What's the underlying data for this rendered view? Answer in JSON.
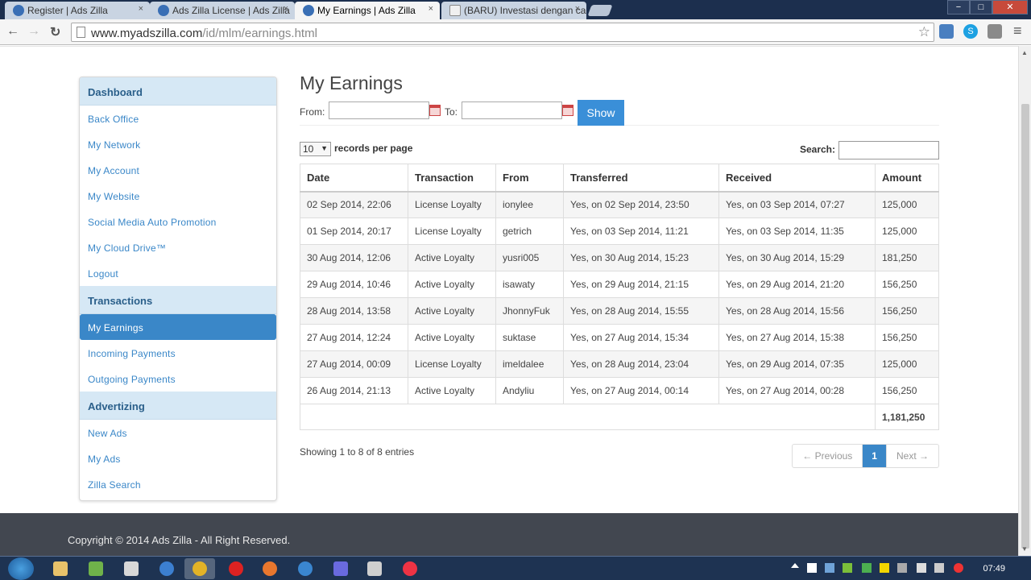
{
  "browser": {
    "tabs": [
      {
        "title": "Register | Ads Zilla",
        "close": "×"
      },
      {
        "title": "Ads Zilla License | Ads Zilla",
        "close": "×"
      },
      {
        "title": "My Earnings | Ads Zilla",
        "close": "×"
      },
      {
        "title": "(BARU) Investasi dengan car",
        "close": "×"
      }
    ],
    "url_host": "www.myadszilla.com",
    "url_path": "/id/mlm/earnings.html",
    "back": "←",
    "forward": "→",
    "reload": "↻",
    "star": "☆",
    "menu": "≡",
    "window_minimize": "−",
    "window_maximize": "□",
    "window_close": "✕"
  },
  "sidebar": {
    "sections": [
      {
        "title": "Dashboard",
        "items": [
          "Back Office",
          "My Network",
          "My Account",
          "My Website",
          "Social Media Auto Promotion",
          "My Cloud Drive™",
          "Logout"
        ]
      },
      {
        "title": "Transactions",
        "items": [
          "My Earnings",
          "Incoming Payments",
          "Outgoing Payments"
        ]
      },
      {
        "title": "Advertizing",
        "items": [
          "New Ads",
          "My Ads",
          "Zilla Search"
        ]
      }
    ]
  },
  "main": {
    "title": "My Earnings",
    "from_label": "From:",
    "to_label": "To:",
    "show_label": "Show",
    "length_value": "10",
    "length_label": "records per page",
    "search_label": "Search:",
    "columns": [
      "Date",
      "Transaction",
      "From",
      "Transferred",
      "Received",
      "Amount"
    ],
    "rows": [
      [
        "02 Sep 2014, 22:06",
        "License Loyalty",
        "ionylee",
        "Yes, on 02 Sep 2014, 23:50",
        "Yes, on 03 Sep 2014, 07:27",
        "125,000"
      ],
      [
        "01 Sep 2014, 20:17",
        "License Loyalty",
        "getrich",
        "Yes, on 03 Sep 2014, 11:21",
        "Yes, on 03 Sep 2014, 11:35",
        "125,000"
      ],
      [
        "30 Aug 2014, 12:06",
        "Active Loyalty",
        "yusri005",
        "Yes, on 30 Aug 2014, 15:23",
        "Yes, on 30 Aug 2014, 15:29",
        "181,250"
      ],
      [
        "29 Aug 2014, 10:46",
        "Active Loyalty",
        "isawaty",
        "Yes, on 29 Aug 2014, 21:15",
        "Yes, on 29 Aug 2014, 21:20",
        "156,250"
      ],
      [
        "28 Aug 2014, 13:58",
        "Active Loyalty",
        "JhonnyFuk",
        "Yes, on 28 Aug 2014, 15:55",
        "Yes, on 28 Aug 2014, 15:56",
        "156,250"
      ],
      [
        "27 Aug 2014, 12:24",
        "Active Loyalty",
        "suktase",
        "Yes, on 27 Aug 2014, 15:34",
        "Yes, on 27 Aug 2014, 15:38",
        "156,250"
      ],
      [
        "27 Aug 2014, 00:09",
        "License Loyalty",
        "imeldalee",
        "Yes, on 28 Aug 2014, 23:04",
        "Yes, on 29 Aug 2014, 07:35",
        "125,000"
      ],
      [
        "26 Aug 2014, 21:13",
        "Active Loyalty",
        "Andyliu",
        "Yes, on 27 Aug 2014, 00:14",
        "Yes, on 27 Aug 2014, 00:28",
        "156,250"
      ]
    ],
    "total": "1,181,250",
    "info": "Showing 1 to 8 of 8 entries",
    "pager": {
      "prev": "← Previous",
      "current": "1",
      "next": "Next →"
    }
  },
  "footer": {
    "text": "Copyright © 2014 Ads Zilla - All Right Reserved."
  },
  "taskbar": {
    "clock": "07:49"
  }
}
